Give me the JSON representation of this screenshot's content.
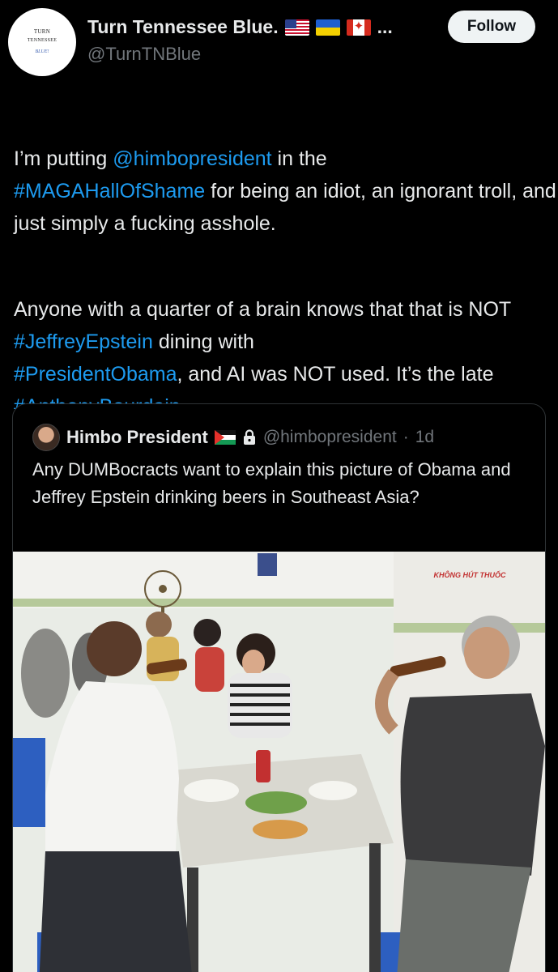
{
  "header": {
    "avatar_text": {
      "line1": "TURN",
      "line2": "TENNESSEE",
      "line3": "BLUE!"
    },
    "display_name": "Turn Tennessee Blue.",
    "ellipsis": "...",
    "handle": "@TurnTNBlue",
    "follow_label": "Follow",
    "flags": [
      "us-flag-icon",
      "ukraine-flag-icon",
      "canada-flag-icon"
    ]
  },
  "tweet": {
    "p1": {
      "t1": "I’m putting ",
      "mention": "@himbopresident",
      "t2": " in the",
      "hashtag": "#MAGAHallOfShame",
      "t3": " for being an idiot, an ignorant troll, and just simply a fucking asshole."
    },
    "p2": {
      "t1": "Anyone with a quarter of a brain knows that that is NOT ",
      "hashtag1": "#JeffreyEpstein",
      "t2": " dining with ",
      "hashtag2": "#PresidentObama",
      "t3": ", and AI was NOT used. It’s the late ",
      "hashtag3": "#AnthonyBourdain",
      "t4": "."
    }
  },
  "quote": {
    "name": "Himbo President",
    "handle": "@himbopresident",
    "time": "1d",
    "separator": "·",
    "text": "Any DUMBocracts want to explain this picture of Obama and Jeffrey Epstein drinking beers in Southeast Asia?",
    "photo_sign": "KHÔNG HÚT THUỐC"
  },
  "colors": {
    "background": "#000000",
    "text": "#e7e9ea",
    "secondary": "#71767b",
    "link": "#1d9bf0",
    "follow_bg": "#eff3f4"
  }
}
